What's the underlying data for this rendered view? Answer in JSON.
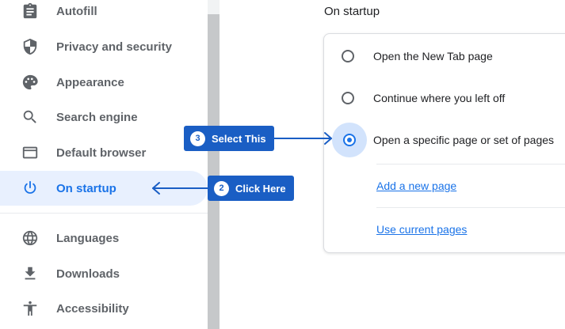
{
  "sidebar": {
    "items": [
      {
        "label": "Autofill",
        "icon": "clipboard-icon"
      },
      {
        "label": "Privacy and security",
        "icon": "shield-icon"
      },
      {
        "label": "Appearance",
        "icon": "palette-icon"
      },
      {
        "label": "Search engine",
        "icon": "search-icon"
      },
      {
        "label": "Default browser",
        "icon": "browser-window-icon"
      },
      {
        "label": "On startup",
        "icon": "power-icon",
        "active": true
      },
      {
        "label": "Languages",
        "icon": "globe-icon"
      },
      {
        "label": "Downloads",
        "icon": "download-icon"
      },
      {
        "label": "Accessibility",
        "icon": "accessibility-icon"
      }
    ]
  },
  "main": {
    "section_title": "On startup",
    "options": [
      {
        "label": "Open the New Tab page",
        "checked": false
      },
      {
        "label": "Continue where you left off",
        "checked": false
      },
      {
        "label": "Open a specific page or set of pages",
        "checked": true
      }
    ],
    "links": {
      "add_page": "Add a new page",
      "use_current": "Use current pages"
    }
  },
  "annotations": {
    "select": {
      "number": "3",
      "text": "Select This"
    },
    "click": {
      "number": "2",
      "text": "Click Here"
    }
  },
  "colors": {
    "accent": "#1a73e8",
    "callout": "#1a5ec4",
    "active_bg": "#e8f0fe",
    "text_secondary": "#5f6368"
  }
}
